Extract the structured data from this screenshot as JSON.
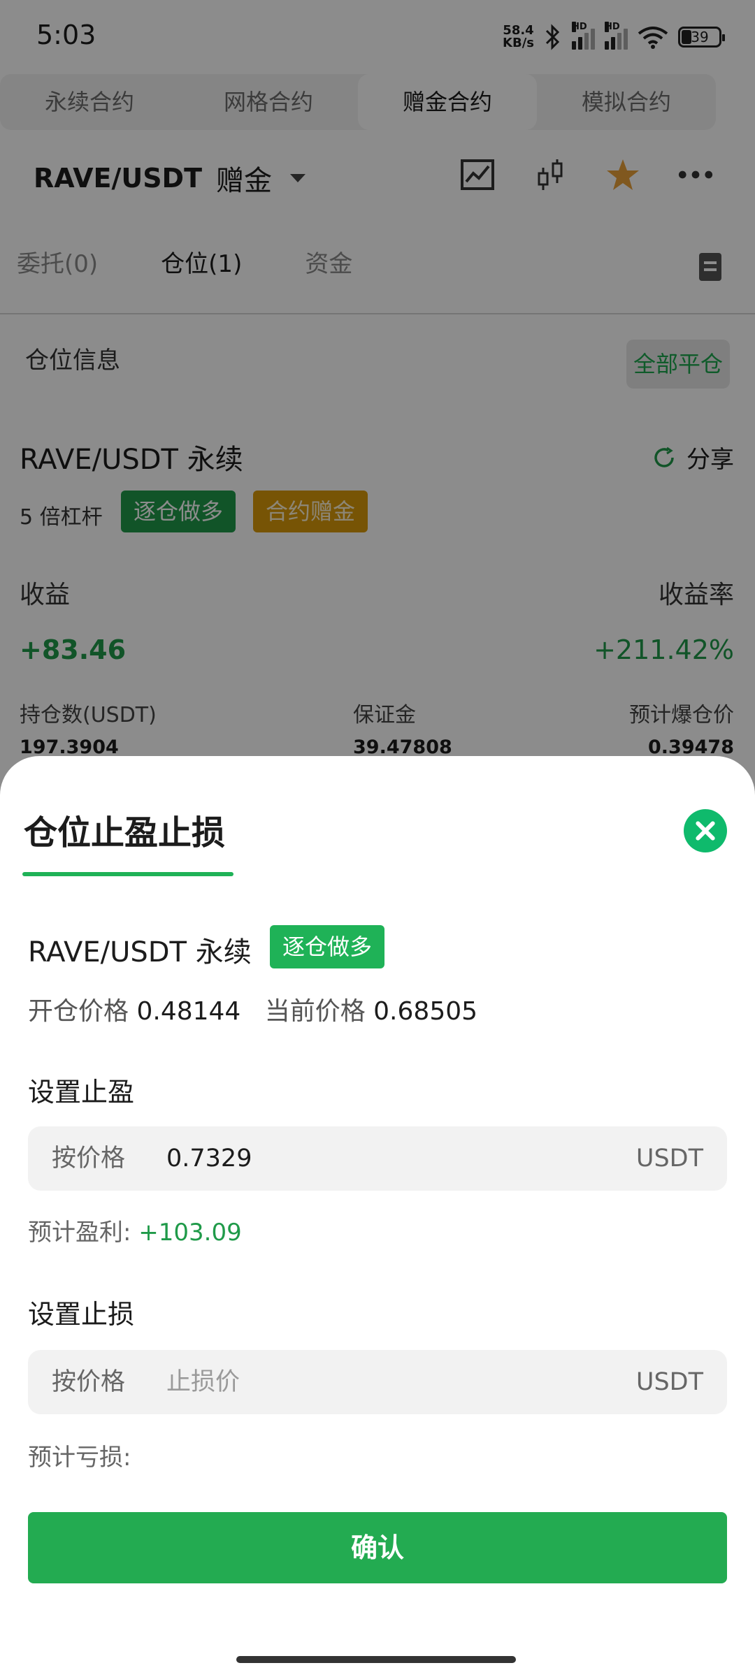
{
  "status_bar": {
    "time": "5:03",
    "net_speed_value": "58.4",
    "net_speed_unit": "KB/s",
    "hd": "HD",
    "battery": "39"
  },
  "contract_tabs": [
    {
      "label": "永续合约",
      "active": false
    },
    {
      "label": "网格合约",
      "active": false
    },
    {
      "label": "赠金合约",
      "active": true
    },
    {
      "label": "模拟合约",
      "active": false
    }
  ],
  "pair_header": {
    "symbol": "RAVE/USDT",
    "bonus": "赠金"
  },
  "sub_tabs": [
    "委托(0)",
    "仓位(1)",
    "资金"
  ],
  "position_section": {
    "title": "仓位信息",
    "close_all": "全部平仓"
  },
  "position": {
    "title": "RAVE/USDT 永续",
    "share": "分享",
    "leverage": "5 倍杠杆",
    "mode_tag": "逐仓做多",
    "bonus_tag": "合约赠金",
    "pnl_label": "收益",
    "pnl_value": "+83.46",
    "roe_label": "收益率",
    "roe_value": "+211.42%",
    "size_label": "持仓数(USDT)",
    "size_value": "197.3904",
    "margin_label": "保证金",
    "margin_value": "39.47808",
    "liq_label": "预计爆仓价",
    "liq_value": "0.39478"
  },
  "sheet": {
    "title": "仓位止盈止损",
    "pair": "RAVE/USDT 永续",
    "tag": "逐仓做多",
    "open_price_label": "开仓价格",
    "open_price": "0.48144",
    "current_price_label": "当前价格",
    "current_price": "0.68505",
    "tp": {
      "title": "设置止盈",
      "by_label": "按价格",
      "value": "0.7329",
      "placeholder": "",
      "unit": "USDT",
      "est_label": "预计盈利:",
      "est_value": "+103.09"
    },
    "sl": {
      "title": "设置止损",
      "by_label": "按价格",
      "value": "",
      "placeholder": "止损价",
      "unit": "USDT",
      "est_label": "预计亏损:",
      "est_value": ""
    },
    "confirm": "确认"
  },
  "colors": {
    "accent_green": "#23ab51",
    "profit_green": "#1f9a49",
    "star": "#e9a13a",
    "close_button": "#0fba6c"
  }
}
